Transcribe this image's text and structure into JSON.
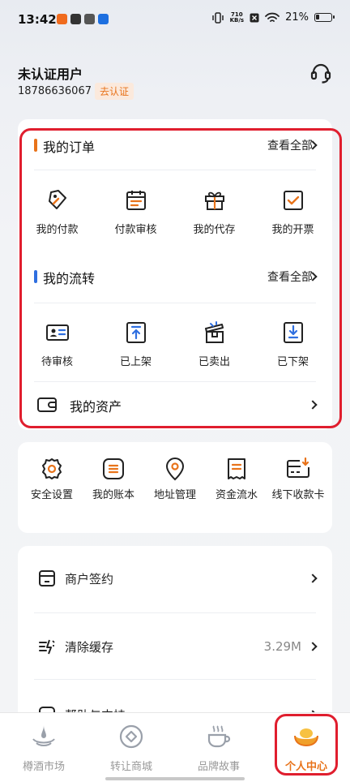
{
  "status_bar": {
    "time": "13:42",
    "net_speed_top": "710",
    "net_speed_bottom": "KB/s",
    "battery": "21%"
  },
  "user": {
    "name": "未认证用户",
    "phone": "18786636067",
    "verify_label": "去认证"
  },
  "orders": {
    "title": "我的订单",
    "see_all": "查看全部",
    "accent": "#e8731a",
    "items": [
      {
        "label": "我的付款",
        "icon": "price-tag-icon"
      },
      {
        "label": "付款审核",
        "icon": "calendar-icon"
      },
      {
        "label": "我的代存",
        "icon": "gift-box-icon"
      },
      {
        "label": "我的开票",
        "icon": "checkbox-icon"
      }
    ]
  },
  "circulation": {
    "title": "我的流转",
    "see_all": "查看全部",
    "accent": "#2f6fe0",
    "items": [
      {
        "label": "待审核",
        "icon": "id-card-icon"
      },
      {
        "label": "已上架",
        "icon": "upload-box-icon"
      },
      {
        "label": "已卖出",
        "icon": "open-box-icon"
      },
      {
        "label": "已下架",
        "icon": "download-box-icon"
      }
    ]
  },
  "assets": {
    "label": "我的资产"
  },
  "tools": {
    "items": [
      {
        "label": "安全设置",
        "icon": "gear-icon"
      },
      {
        "label": "我的账本",
        "icon": "ledger-icon"
      },
      {
        "label": "地址管理",
        "icon": "location-pin-icon"
      },
      {
        "label": "资金流水",
        "icon": "receipt-icon"
      },
      {
        "label": "线下收款卡",
        "icon": "bank-card-icon"
      }
    ]
  },
  "settings": {
    "items": [
      {
        "label": "商户签约",
        "value": "",
        "icon": "shop-icon"
      },
      {
        "label": "清除缓存",
        "value": "3.29M",
        "icon": "broom-icon"
      },
      {
        "label": "帮助与支持",
        "value": "",
        "icon": "help-icon"
      }
    ]
  },
  "bottom_nav": {
    "accent": "#e8731a",
    "items": [
      {
        "label": "樽酒市场",
        "icon": "bottle-drop-icon"
      },
      {
        "label": "转让商城",
        "icon": "transfer-icon"
      },
      {
        "label": "品牌故事",
        "icon": "cup-icon"
      },
      {
        "label": "个人中心",
        "icon": "ingot-icon"
      }
    ]
  }
}
